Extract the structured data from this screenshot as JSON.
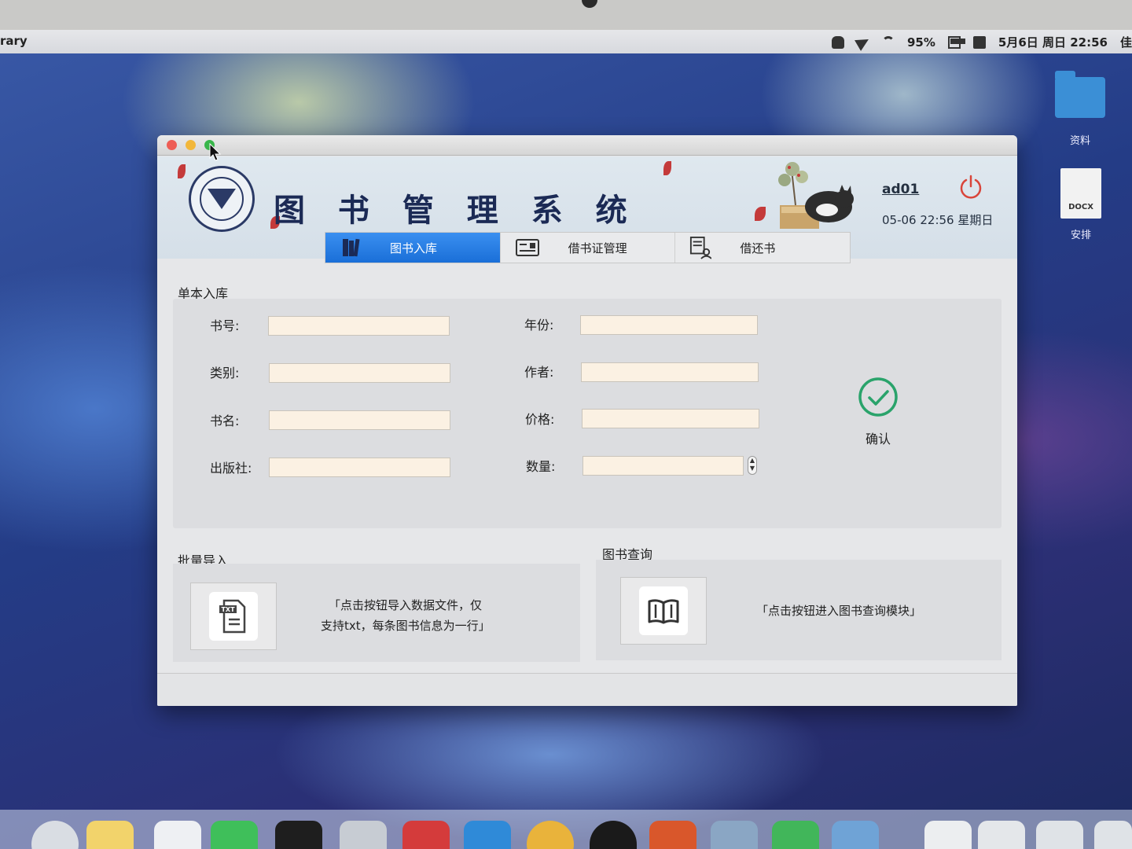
{
  "menubar": {
    "app_name": "rary",
    "battery": "95%",
    "datetime": "5月6日 周日 22:56",
    "user": "佳"
  },
  "desktop": {
    "icons": [
      {
        "label": "资料",
        "kind": "folder"
      },
      {
        "label": "安排",
        "kind": "docx",
        "badge": "DOCX"
      }
    ]
  },
  "window": {
    "title": "图 书 管 理 系 统",
    "user": "ad01",
    "datetime": "05-06 22:56 星期日",
    "tabs": [
      {
        "label": "图书入库",
        "active": true
      },
      {
        "label": "借书证管理",
        "active": false
      },
      {
        "label": "借还书",
        "active": false
      }
    ],
    "single_entry": {
      "section_label": "单本入库",
      "fields": {
        "book_no": {
          "label": "书号:",
          "value": ""
        },
        "category": {
          "label": "类别:",
          "value": ""
        },
        "title": {
          "label": "书名:",
          "value": ""
        },
        "publisher": {
          "label": "出版社:",
          "value": ""
        },
        "year": {
          "label": "年份:",
          "value": ""
        },
        "author": {
          "label": "作者:",
          "value": ""
        },
        "price": {
          "label": "价格:",
          "value": ""
        },
        "quantity": {
          "label": "数量:",
          "value": ""
        }
      },
      "confirm_label": "确认"
    },
    "batch_import": {
      "section_label": "批量导入",
      "hint_line1": "「点击按钮导入数据文件，仅",
      "hint_line2": "支持txt，每条图书信息为一行」",
      "file_badge": "TXT"
    },
    "book_query": {
      "section_label": "图书查询",
      "hint": "「点击按钮进入图书查询模块」"
    }
  },
  "colors": {
    "accent_tab": "#1a6fd8",
    "confirm_green": "#2aa36b",
    "power_red": "#d9453a",
    "input_bg": "#fbf1e3"
  }
}
